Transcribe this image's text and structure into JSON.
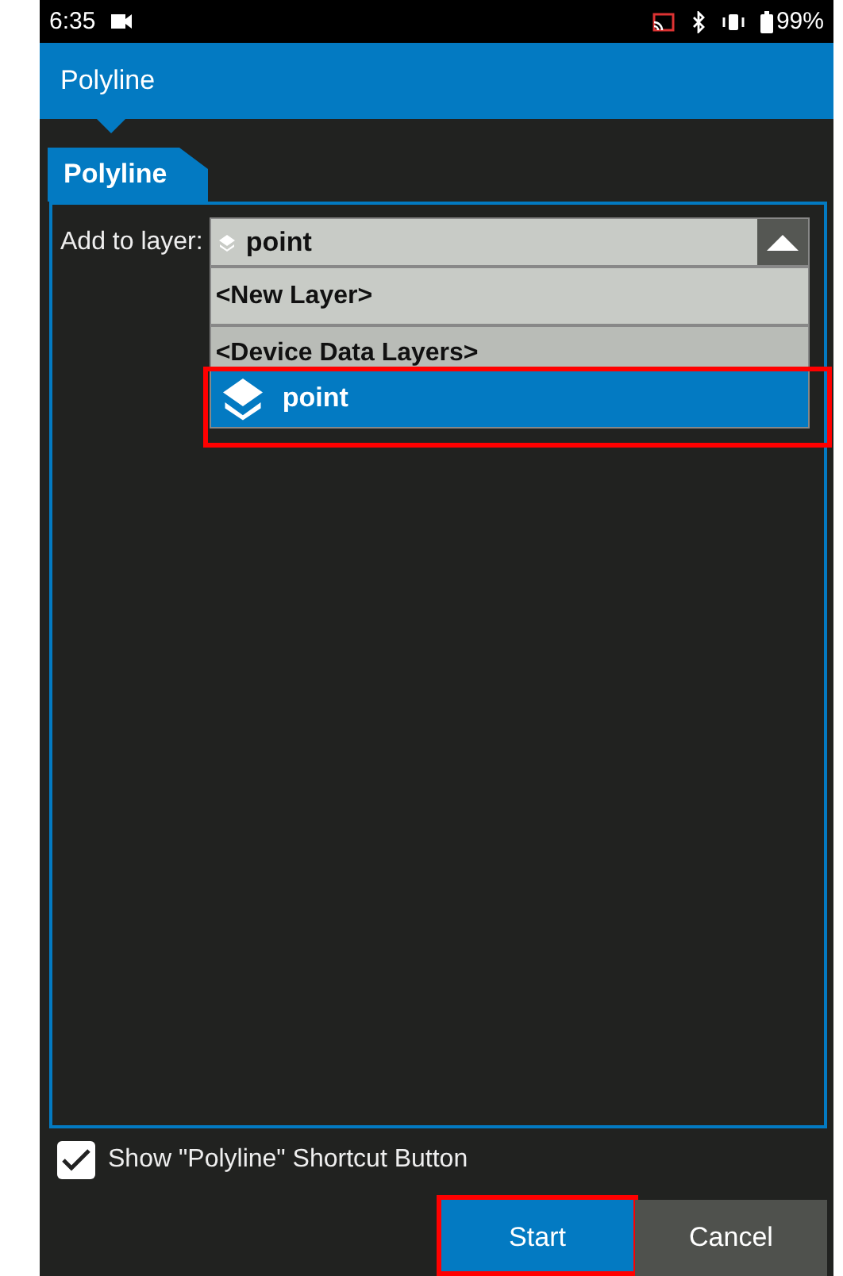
{
  "status_bar": {
    "time": "6:35",
    "battery": "99%"
  },
  "app_bar": {
    "title": "Polyline"
  },
  "tabs": [
    {
      "label": "Polyline",
      "selected": true
    }
  ],
  "layer_field": {
    "label": "Add to layer:",
    "value": "point",
    "expanded": true,
    "options": [
      {
        "label": "<New Layer>",
        "kind": "plain",
        "selected": false,
        "highlighted": false
      },
      {
        "label": "<Device Data Layers>",
        "kind": "header",
        "selected": false,
        "highlighted": false
      },
      {
        "label": "point",
        "kind": "layer",
        "selected": true,
        "highlighted": true
      }
    ]
  },
  "shortcut_checkbox": {
    "label": "Show \"Polyline\" Shortcut Button",
    "checked": true
  },
  "buttons": [
    {
      "label": "Start",
      "kind": "primary",
      "highlighted": true
    },
    {
      "label": "Cancel",
      "kind": "secondary",
      "highlighted": false
    }
  ]
}
